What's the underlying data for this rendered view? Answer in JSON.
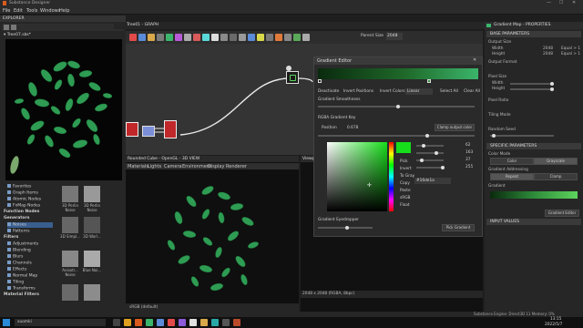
{
  "app": {
    "title": "Substance Designer"
  },
  "menu": [
    "File",
    "Edit",
    "Tools",
    "Windows",
    "Help"
  ],
  "explorer": {
    "header": "EXPLORER",
    "file": "Tree07.sbs*",
    "graph": "Tree01"
  },
  "graph": {
    "tab": "Tree01 - GRAPH",
    "parent_size_label": "Parent Size",
    "parent_size_value": "2048"
  },
  "library": {
    "items": [
      "Favorites",
      "Graph Items",
      "Atomic Nodes",
      "FxMap Nodes",
      "Function Nodes",
      "Generators",
      "Noises",
      "Patterns",
      "Filters",
      "Adjustments",
      "Blending",
      "Blurs",
      "Channels",
      "Effects",
      "Normal Map",
      "Tiling",
      "Transforms",
      "Material Filters"
    ],
    "tiles": [
      "3D Perlin Noise",
      "3D Perlin Noise",
      "3D Simpl...",
      "3D Worl...",
      "Anisotr... Noise",
      "Blue Noi..."
    ]
  },
  "view3d": {
    "tab": "Rounded Cube - OpenGL - 3D VIEW",
    "tabs": [
      "Materials",
      "Lights",
      "Camera",
      "Environment",
      "Display",
      "Renderer"
    ],
    "footer": "sRGB (default)"
  },
  "view2d": {
    "tab": "Viewport",
    "footer": "2048 x 2048 (RGBA, 8bpc)"
  },
  "properties": {
    "header": "Gradient Map - PROPERTIES",
    "base_params": "BASE PARAMETERS",
    "output_size": "Output Size",
    "width": "Width",
    "height": "Height",
    "width_val": "2048",
    "height_val": "2048",
    "equal_label": "Equal > 1",
    "output_format": "Output Format",
    "pixel_size": "Pixel Size",
    "pixel_ratio": "Pixel Ratio",
    "tiling_mode": "Tiling Mode",
    "random_seed": "Random Seed",
    "specific_params": "SPECIFIC PARAMETERS",
    "color_mode": "Color Mode",
    "color_opt": "Color",
    "grayscale_opt": "Grayscale",
    "gradient_addressing": "Gradient Addressing",
    "repeat": "Repeat",
    "clamp": "Clamp",
    "gradient": "Gradient",
    "gradient_editor_btn": "Gradient Editor",
    "input_values": "INPUT VALUES"
  },
  "dialog": {
    "title": "Gradient Editor",
    "deactivate": "Deactivate",
    "invert_positions": "Invert Positions",
    "invert_colors": "Invert Colors",
    "interp": "Linear",
    "select_all": "Select All",
    "clear_all": "Clear All",
    "gradient_smoothness": "Gradient Smoothness",
    "rgba_key": "RGBA Gradient Key",
    "position_label": "Position",
    "position_value": "0.678",
    "clamp_output": "Clamp output color",
    "side_labels": [
      "Pick",
      "Invert",
      "To Gray",
      "Copy",
      "Paste",
      "sRGB",
      "Float"
    ],
    "hex_value": "#16de1a",
    "channel_values": [
      "62",
      "163",
      "37",
      "255"
    ],
    "eyedropper_title": "Gradient Eyedropper",
    "pick_gradient": "Pick Gradient"
  },
  "status": {
    "text": "Substance Engine: Direct3D 11  Memory: 0%"
  },
  "taskbar": {
    "search": "xuomki",
    "time": "13:15",
    "date": "2022/5/7"
  },
  "colors": {
    "accent_green": "#2e8b3a",
    "leaf_green": "#2e9c53",
    "node_red": "#c0282a"
  }
}
